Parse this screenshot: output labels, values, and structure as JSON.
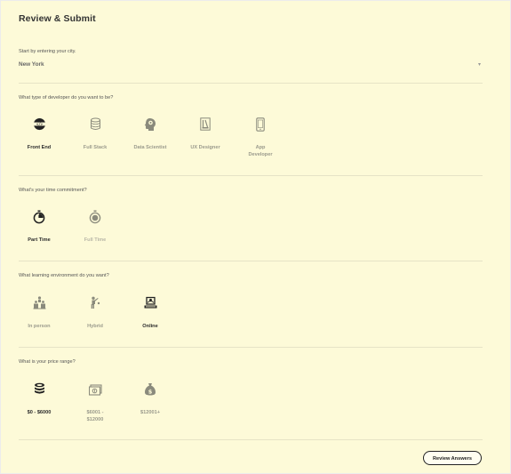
{
  "page_title": "Review & Submit",
  "city": {
    "question": "Start by entering your city.",
    "value": "New York"
  },
  "developer": {
    "question": "What type of developer do you want to be?",
    "options": [
      {
        "label": "Front End",
        "icon": "code-globe-icon",
        "selected": true
      },
      {
        "label": "Full Stack",
        "icon": "database-icon",
        "selected": false
      },
      {
        "label": "Data Scientist",
        "icon": "head-brain-icon",
        "selected": false
      },
      {
        "label": "UX Designer",
        "icon": "design-tools-icon",
        "selected": false
      },
      {
        "label": "App Developer",
        "icon": "smartphone-icon",
        "selected": false
      }
    ]
  },
  "commitment": {
    "question": "What's your time commitment?",
    "options": [
      {
        "label": "Part Time",
        "icon": "stopwatch-icon",
        "selected": true
      },
      {
        "label": "Full Time",
        "icon": "stopwatch-full-icon",
        "selected": false
      }
    ]
  },
  "environment": {
    "question": "What learning environment do you want?",
    "options": [
      {
        "label": "In person",
        "icon": "classroom-icon",
        "selected": false
      },
      {
        "label": "Hybrid",
        "icon": "person-presenting-icon",
        "selected": false
      },
      {
        "label": "Online",
        "icon": "laptop-online-icon",
        "selected": true
      }
    ]
  },
  "price": {
    "question": "What is your price range?",
    "options": [
      {
        "label": "$0 - $6000",
        "icon": "coin-stack-icon",
        "selected": true
      },
      {
        "label": "$6001 - $12000",
        "icon": "cash-icon",
        "selected": false
      },
      {
        "label": "$12001+",
        "icon": "money-bag-icon",
        "selected": false
      }
    ]
  },
  "actions": {
    "review_label": "Review Answers"
  },
  "colors": {
    "background": "#fdfad8",
    "selected_text": "#2b2b2b",
    "unselected_text": "#9a9a8c",
    "selected_icon": "#222222",
    "unselected_icon": "#8a8a7c"
  }
}
